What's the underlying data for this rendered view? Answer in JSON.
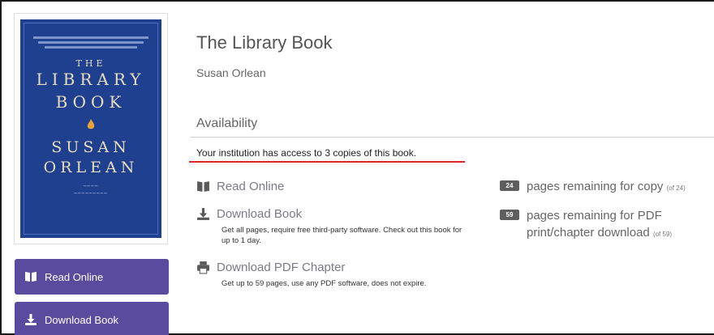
{
  "cover": {
    "line_the": "THE",
    "line_library": "LIBRARY",
    "line_book": "BOOK",
    "line_susan": "SUSAN",
    "line_orlean": "ORLEAN"
  },
  "sidebar": {
    "read_online_label": "Read Online",
    "download_book_label": "Download Book"
  },
  "book": {
    "title": "The Library Book",
    "author": "Susan Orlean"
  },
  "availability": {
    "heading": "Availability",
    "access_text": "Your institution has access to 3 copies of this book."
  },
  "options": {
    "read_online": {
      "label": "Read Online"
    },
    "download_book": {
      "label": "Download Book",
      "description": "Get all pages, require free third-party software. Check out this book for up to 1 day."
    },
    "download_pdf_chapter": {
      "label": "Download PDF Chapter",
      "description": "Get up to 59 pages, use any PDF software, does not expire."
    }
  },
  "remaining": {
    "copy": {
      "count": "24",
      "text": "pages remaining for copy",
      "of": "(of 24)"
    },
    "pdf": {
      "count": "59",
      "text_line1": "pages remaining for PDF",
      "text_line2": "print/chapter download",
      "of": "(of 59)"
    }
  },
  "colors": {
    "button_bg": "#5a4b9e",
    "cover_bg": "#1f3f8f",
    "underline_red": "#e0232a",
    "badge_bg": "#5e5e5e"
  }
}
